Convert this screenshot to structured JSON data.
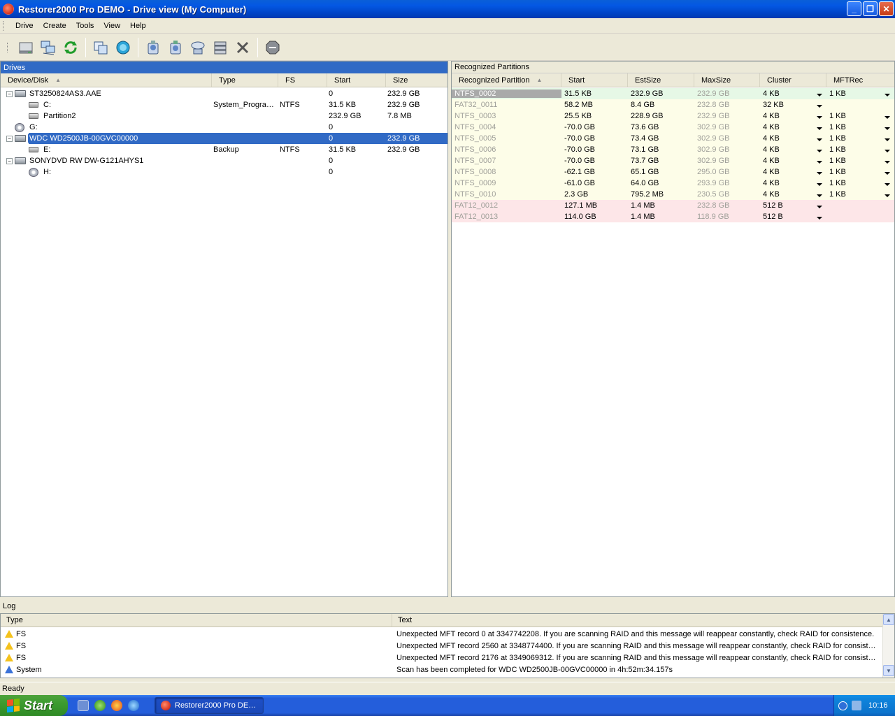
{
  "window": {
    "title": "Restorer2000 Pro DEMO - Drive view (My Computer)"
  },
  "menu": [
    "Drive",
    "Create",
    "Tools",
    "View",
    "Help"
  ],
  "toolbar": {
    "icons": [
      "drive-icon",
      "network-icon",
      "refresh-icon",
      "copy-icon",
      "scan-icon",
      "open-icon",
      "open-file-icon",
      "find-icon",
      "image-icon",
      "delete-icon",
      "stop-icon"
    ]
  },
  "drives": {
    "title": "Drives",
    "columns": [
      "Device/Disk",
      "Type",
      "FS",
      "Start",
      "Size"
    ],
    "rows": [
      {
        "name": "ST3250824AS3.AAE",
        "type": "",
        "fs": "",
        "start": "0",
        "size": "232.9 GB",
        "level": 0,
        "icon": "disk-icon",
        "expander": "−"
      },
      {
        "name": "C:",
        "type": "System_Program…",
        "fs": "NTFS",
        "start": "31.5 KB",
        "size": "232.9 GB",
        "level": 1,
        "icon": "partition-icon",
        "expander": ""
      },
      {
        "name": "Partition2",
        "type": "",
        "fs": "",
        "start": "232.9 GB",
        "size": "7.8 MB",
        "level": 1,
        "icon": "partition-icon",
        "expander": ""
      },
      {
        "name": "G:",
        "type": "",
        "fs": "",
        "start": "0",
        "size": "",
        "level": 0,
        "icon": "cd-icon",
        "expander": ""
      },
      {
        "name": "WDC WD2500JB-00GVC00000",
        "type": "",
        "fs": "",
        "start": "0",
        "size": "232.9 GB",
        "level": 0,
        "icon": "disk-icon",
        "expander": "−",
        "selected": true
      },
      {
        "name": "E:",
        "type": "Backup",
        "fs": "NTFS",
        "start": "31.5 KB",
        "size": "232.9 GB",
        "level": 1,
        "icon": "partition-icon",
        "expander": ""
      },
      {
        "name": "SONYDVD RW DW-G121AHYS1",
        "type": "",
        "fs": "",
        "start": "0",
        "size": "",
        "level": 0,
        "icon": "disk-icon",
        "expander": "−"
      },
      {
        "name": "H:",
        "type": "",
        "fs": "",
        "start": "0",
        "size": "",
        "level": 1,
        "icon": "cd-icon",
        "expander": ""
      }
    ]
  },
  "recognized": {
    "title": "Recognized Partitions",
    "columns": [
      "Recognized Partition",
      "Start",
      "EstSize",
      "MaxSize",
      "Cluster",
      "MFTRec"
    ],
    "rows": [
      {
        "name": "NTFS_0002",
        "start": "31.5 KB",
        "est": "232.9 GB",
        "max": "232.9 GB",
        "cluster": "4 KB",
        "mft": "1 KB",
        "bg": "#e6f8e6",
        "mftdd": true
      },
      {
        "name": "FAT32_0011",
        "start": "58.2 MB",
        "est": "8.4 GB",
        "max": "232.8 GB",
        "cluster": "32 KB",
        "mft": "",
        "bg": "#fdfde8",
        "mftdd": false
      },
      {
        "name": "NTFS_0003",
        "start": "25.5 KB",
        "est": "228.9 GB",
        "max": "232.9 GB",
        "cluster": "4 KB",
        "mft": "1 KB",
        "bg": "#fdfde8",
        "mftdd": true
      },
      {
        "name": "NTFS_0004",
        "start": "-70.0 GB",
        "est": "73.6 GB",
        "max": "302.9 GB",
        "cluster": "4 KB",
        "mft": "1 KB",
        "bg": "#fdfde8",
        "mftdd": true
      },
      {
        "name": "NTFS_0005",
        "start": "-70.0 GB",
        "est": "73.4 GB",
        "max": "302.9 GB",
        "cluster": "4 KB",
        "mft": "1 KB",
        "bg": "#fdfde8",
        "mftdd": true
      },
      {
        "name": "NTFS_0006",
        "start": "-70.0 GB",
        "est": "73.1 GB",
        "max": "302.9 GB",
        "cluster": "4 KB",
        "mft": "1 KB",
        "bg": "#fdfde8",
        "mftdd": true
      },
      {
        "name": "NTFS_0007",
        "start": "-70.0 GB",
        "est": "73.7 GB",
        "max": "302.9 GB",
        "cluster": "4 KB",
        "mft": "1 KB",
        "bg": "#fdfde8",
        "mftdd": true
      },
      {
        "name": "NTFS_0008",
        "start": "-62.1 GB",
        "est": "65.1 GB",
        "max": "295.0 GB",
        "cluster": "4 KB",
        "mft": "1 KB",
        "bg": "#fdfde8",
        "mftdd": true
      },
      {
        "name": "NTFS_0009",
        "start": "-61.0 GB",
        "est": "64.0 GB",
        "max": "293.9 GB",
        "cluster": "4 KB",
        "mft": "1 KB",
        "bg": "#fdfde8",
        "mftdd": true
      },
      {
        "name": "NTFS_0010",
        "start": "2.3 GB",
        "est": "795.2 MB",
        "max": "230.5 GB",
        "cluster": "4 KB",
        "mft": "1 KB",
        "bg": "#fdfde8",
        "mftdd": true
      },
      {
        "name": "FAT12_0012",
        "start": "127.1 MB",
        "est": "1.4 MB",
        "max": "232.8 GB",
        "cluster": "512 B",
        "mft": "",
        "bg": "#fde6e8",
        "mftdd": false
      },
      {
        "name": "FAT12_0013",
        "start": "114.0 GB",
        "est": "1.4 MB",
        "max": "118.9 GB",
        "cluster": "512 B",
        "mft": "",
        "bg": "#fde6e8",
        "mftdd": false
      }
    ]
  },
  "log": {
    "title": "Log",
    "columns": [
      "Type",
      "Text"
    ],
    "rows": [
      {
        "type": "FS",
        "icon": "warning-icon",
        "text": "Unexpected MFT record 0 at 3347742208. If you are scanning RAID and this message will reappear constantly, check RAID for consistence."
      },
      {
        "type": "FS",
        "icon": "warning-icon",
        "text": "Unexpected MFT record 2560 at 3348774400. If you are scanning RAID and this message will reappear constantly, check RAID for consisten…"
      },
      {
        "type": "FS",
        "icon": "warning-icon",
        "text": "Unexpected MFT record 2176 at 3349069312. If you are scanning RAID and this message will reappear constantly, check RAID for consisten…"
      },
      {
        "type": "System",
        "icon": "info-icon",
        "text": "Scan has been completed for WDC WD2500JB-00GVC00000 in 4h:52m:34.157s"
      }
    ]
  },
  "status": "Ready",
  "taskbar": {
    "start": "Start",
    "task": "Restorer2000 Pro DE…",
    "clock": "10:16"
  }
}
